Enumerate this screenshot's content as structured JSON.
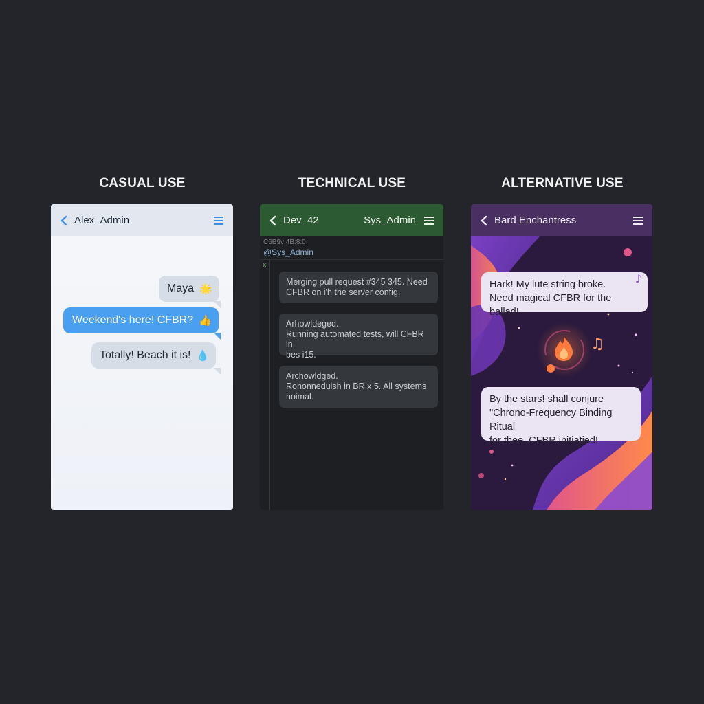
{
  "columns": {
    "casual": {
      "title": "CASUAL USE",
      "header": {
        "contact": "Alex_Admin"
      },
      "messages": [
        {
          "text": "Maya",
          "emoji": "🌟",
          "style": "received"
        },
        {
          "text": "Weekend's here! CFBR?",
          "emoji": "👍",
          "style": "sent"
        },
        {
          "text": "Totally! Beach it is!",
          "emoji": "💧",
          "style": "received"
        }
      ]
    },
    "technical": {
      "title": "TECHNICAL USE",
      "header": {
        "contact": "Dev_42",
        "contact_right": "Sys_Admin"
      },
      "system_line": "C6B9v 4B:8:0",
      "mention": "@Sys_Admin",
      "gutter_mark": "x",
      "messages": [
        {
          "line1": "Merging pull request #345  345. Need",
          "line2": "CFBR on i'h the server config.",
          "line3": ""
        },
        {
          "line1": "Arhowldeged.",
          "line2": "Running automated tests, will CFBR in",
          "line3": "bes i15."
        },
        {
          "line1": "Archowldged.",
          "line2": "Rohonneduish in BR x 5. All systems",
          "line3": "noimal."
        }
      ]
    },
    "alternative": {
      "title": "ALTERNATIVE USE",
      "header": {
        "contact": "Bard Enchantress"
      },
      "messages": [
        {
          "line1": "Hark! My lute string broke.",
          "line2": "Need magical CFBR for the ballad!",
          "line3": ""
        },
        {
          "line1": "By the stars! shall conjure",
          "line2": "\"Chrono-Frequency Binding Ritual",
          "line3": "for thee. CFBR initiatied!"
        }
      ],
      "note_glyph": "♪",
      "notes_glyph": "♫"
    }
  },
  "colors": {
    "background": "#23252a",
    "casual_accent": "#3b8ee6",
    "technical_header": "#2b5a33",
    "alternative_header": "#4a2f63"
  },
  "icons": [
    "chevron-left-icon",
    "hamburger-menu-icon",
    "flame-icon",
    "music-note-icon"
  ]
}
